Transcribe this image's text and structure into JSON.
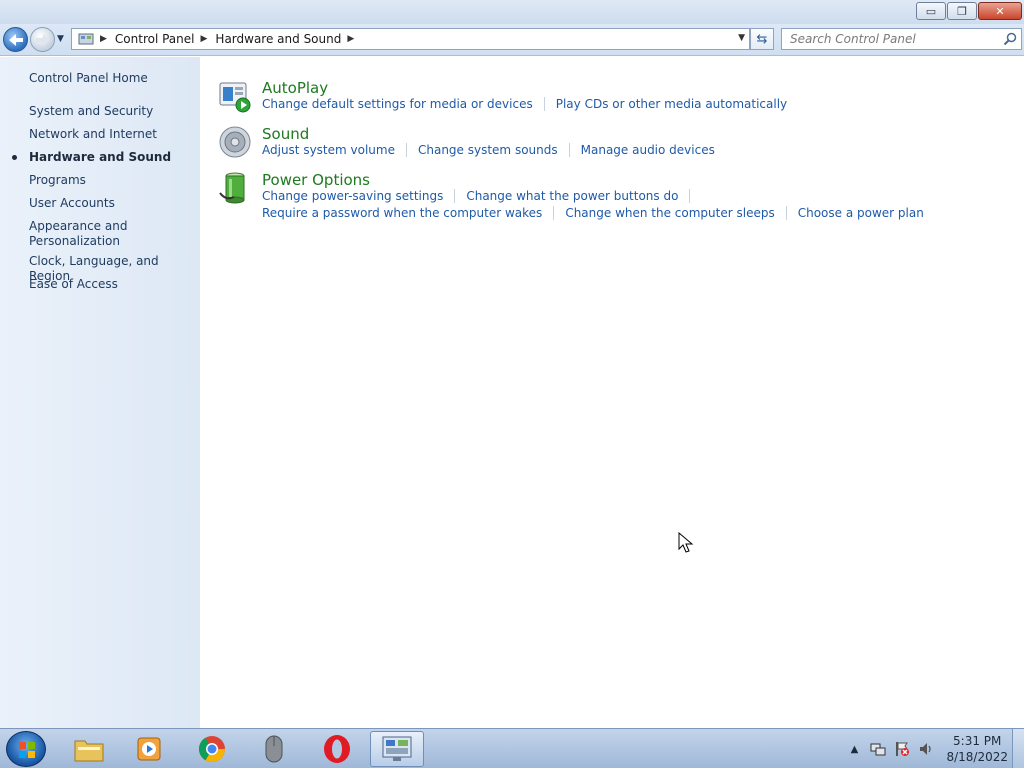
{
  "window": {
    "buttons": {
      "minimize": "▭",
      "maximize": "❐",
      "close": "✕"
    }
  },
  "nav": {
    "breadcrumb": [
      "Control Panel",
      "Hardware and Sound"
    ],
    "search_placeholder": "Search Control Panel"
  },
  "sidebar": {
    "home": "Control Panel Home",
    "items": [
      {
        "label": "System and Security",
        "active": false
      },
      {
        "label": "Network and Internet",
        "active": false
      },
      {
        "label": "Hardware and Sound",
        "active": true
      },
      {
        "label": "Programs",
        "active": false
      },
      {
        "label": "User Accounts",
        "active": false
      },
      {
        "label": "Appearance and\nPersonalization",
        "active": false
      },
      {
        "label": "Clock, Language, and Region",
        "active": false
      },
      {
        "label": "Ease of Access",
        "active": false
      }
    ]
  },
  "categories": [
    {
      "title": "AutoPlay",
      "icon": "autoplay-icon",
      "links": [
        [
          "Change default settings for media or devices",
          "Play CDs or other media automatically"
        ]
      ]
    },
    {
      "title": "Sound",
      "icon": "speaker-icon",
      "links": [
        [
          "Adjust system volume",
          "Change system sounds",
          "Manage audio devices"
        ]
      ]
    },
    {
      "title": "Power Options",
      "icon": "battery-icon",
      "links": [
        [
          "Change power-saving settings",
          "Change what the power buttons do"
        ],
        [
          "Require a password when the computer wakes",
          "Change when the computer sleeps",
          "Choose a power plan"
        ]
      ]
    }
  ],
  "taskbar": {
    "apps": [
      "file-explorer-icon",
      "media-player-icon",
      "chrome-icon",
      "mouse-icon",
      "opera-icon",
      "control-panel-icon"
    ],
    "clock": {
      "time": "5:31 PM",
      "date": "8/18/2022"
    },
    "tray_icons": [
      "show-hidden-icons-arrow",
      "network-icon",
      "action-center-icon",
      "volume-icon"
    ]
  },
  "colors": {
    "category_title": "#1e7a1e",
    "task_link": "#1f5aa8",
    "sidebar_bg": "#e3ecf7",
    "taskbar_bg": "#b2c7e2"
  }
}
